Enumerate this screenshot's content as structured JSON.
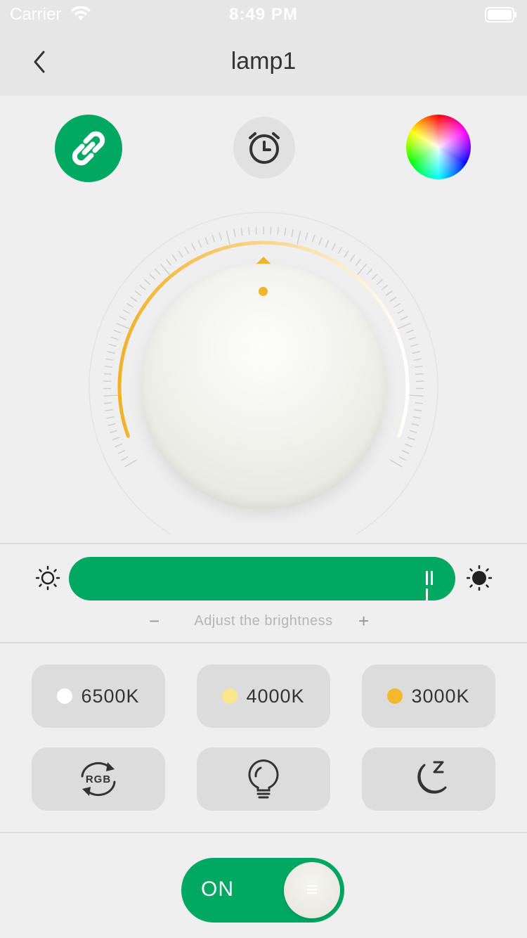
{
  "status_bar": {
    "carrier": "Carrier",
    "time": "8:49 PM"
  },
  "nav": {
    "title": "lamp1"
  },
  "top_actions": {
    "link_icon": "link-icon",
    "alarm_icon": "alarm-clock-icon",
    "color_wheel_icon": "color-wheel-icon",
    "accent": "#00a862"
  },
  "dial": {
    "indicator_color": "#f2b52a"
  },
  "brightness": {
    "label": "Adjust the brightness",
    "minus": "−",
    "plus": "+",
    "level": 1.0
  },
  "color_temps": [
    {
      "label": "6500K",
      "dot": "#ffffff"
    },
    {
      "label": "4000K",
      "dot": "#f7e68a"
    },
    {
      "label": "3000K",
      "dot": "#f3b92b"
    }
  ],
  "modes": [
    {
      "icon": "rgb-cycle-icon",
      "text": "RGB"
    },
    {
      "icon": "lightbulb-icon"
    },
    {
      "icon": "moon-sleep-icon"
    }
  ],
  "power": {
    "label": "ON",
    "state": true
  }
}
